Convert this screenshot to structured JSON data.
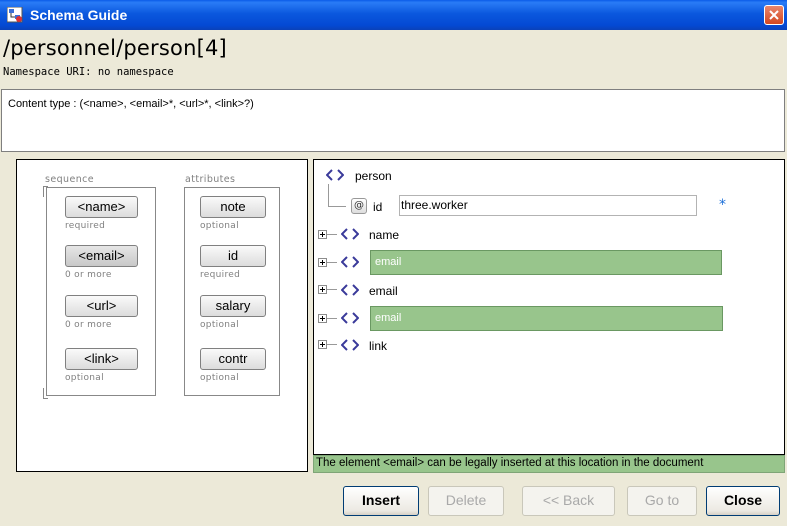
{
  "window": {
    "title": "Schema Guide"
  },
  "header": {
    "path": "/personnel/person[4]",
    "namespace": "Namespace URI: no namespace",
    "content_type": "Content type : (<name>, <email>*, <url>*, <link>?)"
  },
  "left_panel": {
    "sequence_header": "sequence",
    "attributes_header": "attributes",
    "sequence_items": [
      {
        "label": "<name>",
        "occurrence": "required"
      },
      {
        "label": "<email>",
        "occurrence": "0 or more"
      },
      {
        "label": "<url>",
        "occurrence": "0 or more"
      },
      {
        "label": "<link>",
        "occurrence": "optional"
      }
    ],
    "attribute_items": [
      {
        "label": "note",
        "occurrence": "optional"
      },
      {
        "label": "id",
        "occurrence": "required"
      },
      {
        "label": "salary",
        "occurrence": "optional"
      },
      {
        "label": "contr",
        "occurrence": "optional"
      }
    ]
  },
  "tree": {
    "root": "person",
    "attribute": {
      "icon": "@",
      "name": "id",
      "value": "three.worker",
      "required_marker": "*"
    },
    "nodes": [
      {
        "label": "name",
        "placeholder": false
      },
      {
        "label": "email",
        "placeholder": true
      },
      {
        "label": "email",
        "placeholder": false
      },
      {
        "label": "email",
        "placeholder": true
      },
      {
        "label": "link",
        "placeholder": false
      }
    ]
  },
  "status": "The element <email> can be legally inserted at this location in the document",
  "buttons": {
    "insert": "Insert",
    "delete": "Delete",
    "back": "<< Back",
    "goto": "Go to",
    "close": "Close"
  },
  "colors": {
    "titlebar": "#0b58de",
    "placeholder_green": "#98c58c",
    "required_star": "#1a6ed8"
  }
}
